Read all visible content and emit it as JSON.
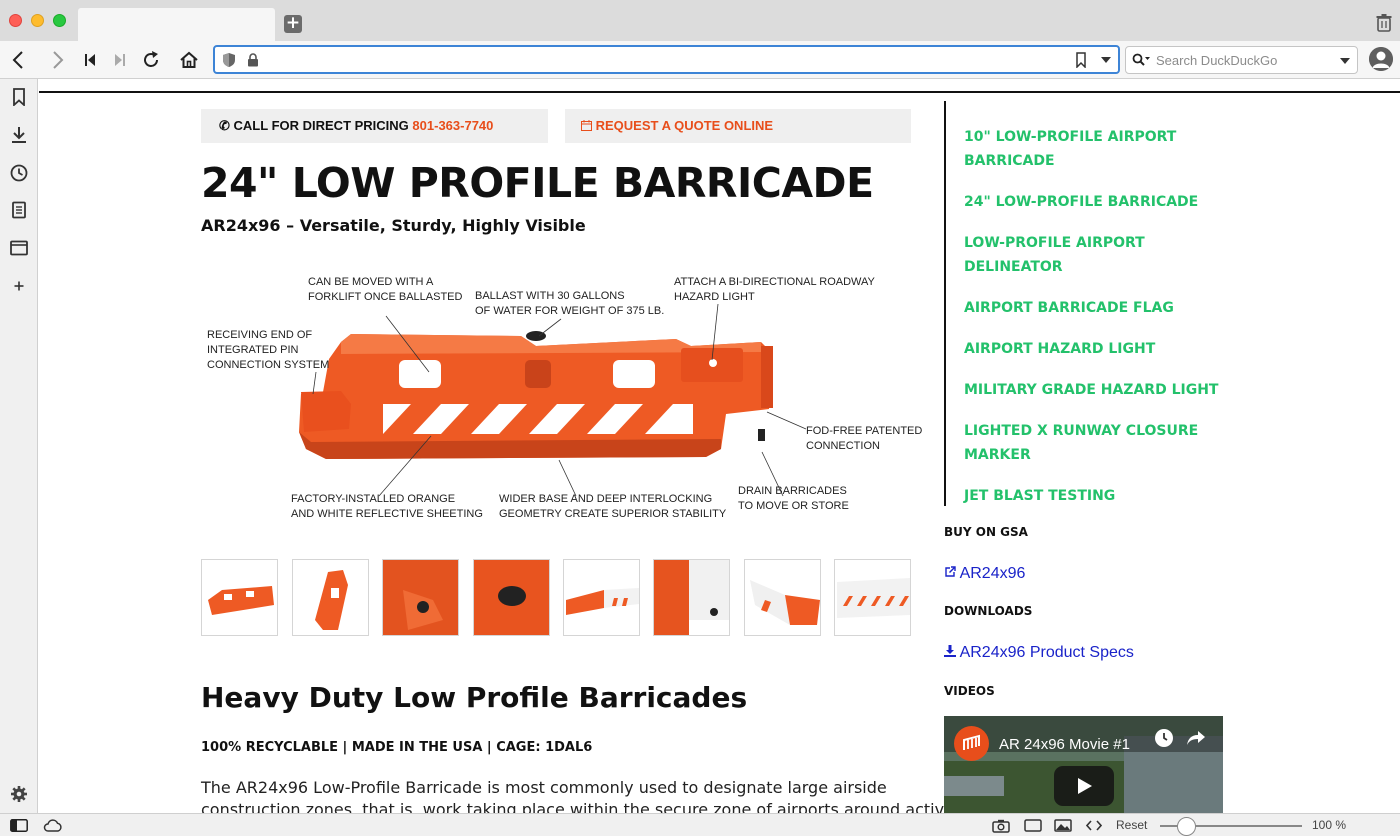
{
  "browser": {
    "search_placeholder": "Search DuckDuckGo",
    "zoom_reset": "Reset",
    "zoom_level": "100 %",
    "accent_color": "#3d84d6"
  },
  "cta": {
    "call_label": "CALL FOR DIRECT PRICING",
    "call_phone": "801-363-7740",
    "quote_label": "REQUEST A QUOTE ONLINE"
  },
  "product": {
    "title": "24\" LOW PROFILE BARRICADE",
    "subtitle": "AR24x96 – Versatile, Sturdy, Highly Visible",
    "callouts": {
      "forklift": [
        "CAN BE MOVED WITH A",
        "FORKLIFT ONCE BALLASTED"
      ],
      "ballast": [
        "BALLAST WITH 30 GALLONS",
        "OF WATER FOR WEIGHT OF 375 LB."
      ],
      "hazard": [
        "ATTACH A BI-DIRECTIONAL ROADWAY",
        "HAZARD LIGHT"
      ],
      "receiving": [
        "RECEIVING END OF",
        "INTEGRATED PIN",
        "CONNECTION SYSTEM"
      ],
      "fod": [
        "FOD-FREE PATENTED",
        "CONNECTION"
      ],
      "sheeting": [
        "FACTORY-INSTALLED ORANGE",
        "AND WHITE REFLECTIVE SHEETING"
      ],
      "base": [
        "WIDER BASE AND DEEP INTERLOCKING",
        "GEOMETRY CREATE SUPERIOR STABILITY"
      ],
      "drain": [
        "DRAIN BARRICADES",
        "TO MOVE OR STORE"
      ]
    },
    "heading2": "Heavy Duty Low Profile Barricades",
    "meta": "100% RECYCLABLE | MADE IN THE USA | CAGE: 1DAL6",
    "body_line1": "The AR24x96 Low-Profile Barricade is most commonly used to designate large airside",
    "body_line2": "construction zones, that is, work taking place within the secure zone of airports around active"
  },
  "sidebar": {
    "links": [
      "10\" LOW-PROFILE AIRPORT BARRICADE",
      "24\" LOW-PROFILE BARRICADE",
      "LOW-PROFILE AIRPORT DELINEATOR",
      "AIRPORT BARRICADE FLAG",
      "AIRPORT HAZARD LIGHT",
      "MILITARY GRADE HAZARD LIGHT",
      "LIGHTED X RUNWAY CLOSURE MARKER",
      "JET BLAST TESTING"
    ],
    "gsa_heading": "BUY ON GSA",
    "gsa_link": "AR24x96",
    "downloads_heading": "DOWNLOADS",
    "download_link": "AR24x96 Product Specs",
    "videos_heading": "VIDEOS",
    "video_title": "AR 24x96 Movie #1"
  },
  "colors": {
    "brand_orange": "#e84e1b",
    "link_green": "#23c16b",
    "link_blue": "#1a23c9"
  }
}
